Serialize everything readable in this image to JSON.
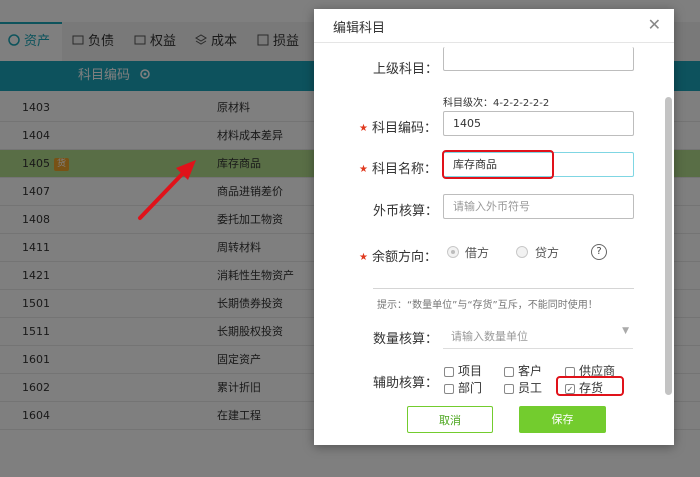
{
  "tabs": [
    {
      "label": "资产",
      "icon": "asset-icon"
    },
    {
      "label": "负债",
      "icon": "liability-icon"
    },
    {
      "label": "权益",
      "icon": "equity-icon"
    },
    {
      "label": "成本",
      "icon": "cost-icon"
    },
    {
      "label": "损益",
      "icon": "profit-loss-icon"
    }
  ],
  "table": {
    "header_code": "科目编码",
    "rows": [
      {
        "code": "1403",
        "name": "原材料"
      },
      {
        "code": "1404",
        "name": "材料成本差异"
      },
      {
        "code": "1405",
        "name": "库存商品",
        "badge": "货"
      },
      {
        "code": "1407",
        "name": "商品进销差价"
      },
      {
        "code": "1408",
        "name": "委托加工物资"
      },
      {
        "code": "1411",
        "name": "周转材料"
      },
      {
        "code": "1421",
        "name": "消耗性生物资产"
      },
      {
        "code": "1501",
        "name": "长期债券投资"
      },
      {
        "code": "1511",
        "name": "长期股权投资"
      },
      {
        "code": "1601",
        "name": "固定资产"
      },
      {
        "code": "1602",
        "name": "累计折旧"
      },
      {
        "code": "1604",
        "name": "在建工程"
      }
    ]
  },
  "dialog": {
    "title": "编辑科目",
    "parent_label": "上级科目：",
    "level_hint": "科目级次：4-2-2-2-2-2",
    "code_label": "科目编码：",
    "code_value": "1405",
    "name_label": "科目名称：",
    "name_value": "库存商品",
    "fx_label": "外币核算：",
    "fx_placeholder": "请输入外币符号",
    "balance_label": "余额方向：",
    "debit_label": "借方",
    "credit_label": "贷方",
    "help": "?",
    "tip": "提示：“数量单位”与“存货”互斥，不能同时使用！",
    "qty_label": "数量核算：",
    "qty_placeholder": "请输入数量单位",
    "aux_label": "辅助核算：",
    "aux_items": [
      "项目",
      "客户",
      "供应商",
      "部门",
      "员工",
      "存货"
    ],
    "cancel": "取消",
    "save": "保存",
    "colors": {
      "accent": "#1ba5ba",
      "save": "#73cc2e",
      "cancel_border": "#73cc2e",
      "highlight": "#e0121a",
      "row_selected": "#b3dc8c"
    }
  }
}
